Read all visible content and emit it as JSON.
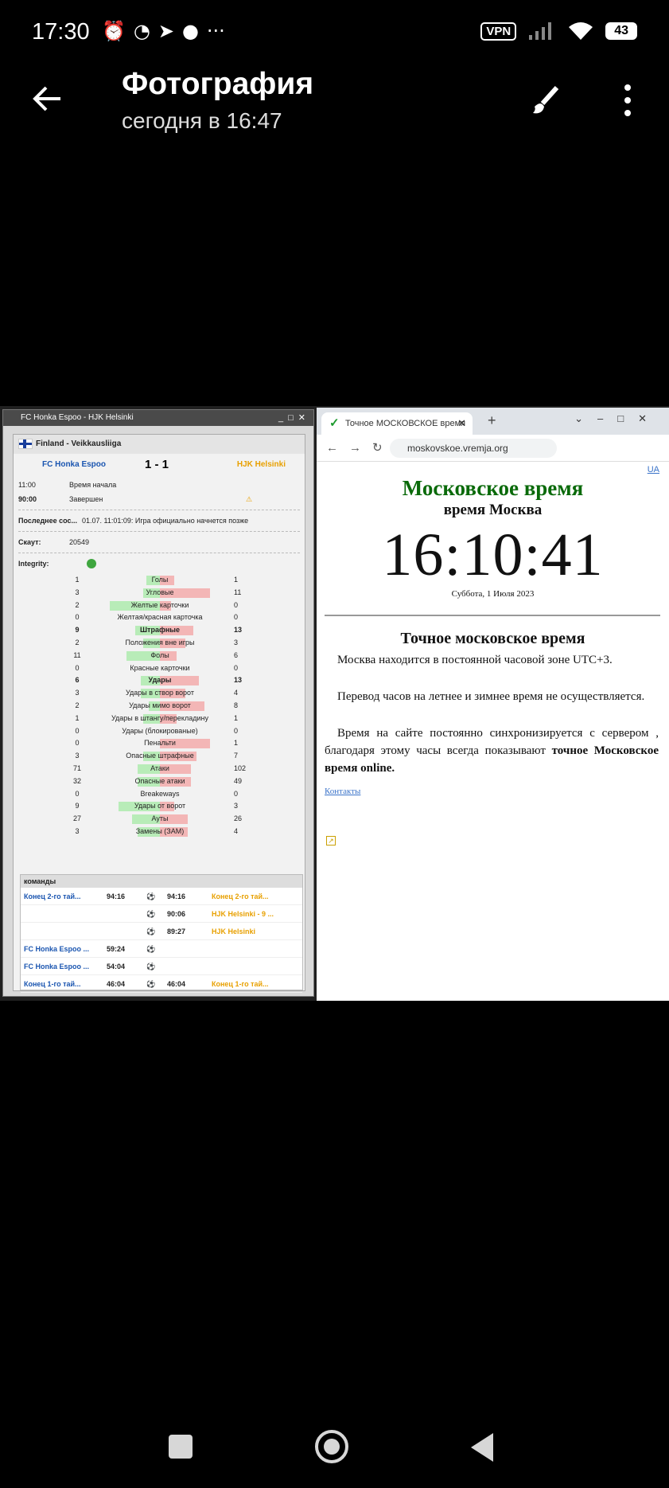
{
  "status": {
    "time": "17:30",
    "vpn": "VPN",
    "battery": "43"
  },
  "appbar": {
    "title": "Фотография",
    "subtitle": "сегодня в 16:47"
  },
  "left_app": {
    "window_title": "FC Honka Espoo - HJK Helsinki",
    "league": "Finland - Veikkausliiga",
    "team1": "FC Honka Espoo",
    "team2": "HJK Helsinki",
    "score": "1 - 1",
    "start_time": "11:00",
    "start_label": "Время начала",
    "minute": "90:00",
    "state": "Завершен",
    "last_msg_label": "Последнее сос...",
    "last_msg": "01.07. 11:01:09: Игра официально начнется позже",
    "scout_label": "Скаут:",
    "scout": "20549",
    "integrity_label": "Integrity:",
    "stats": [
      {
        "l": "1",
        "name": "Голы",
        "r": "1",
        "bold": false,
        "lw": 0.25,
        "rw": 0.25
      },
      {
        "l": "3",
        "name": "Угловые",
        "r": "11",
        "bold": false,
        "lw": 0.3,
        "rw": 0.9
      },
      {
        "l": "2",
        "name": "Желтые карточки",
        "r": "0",
        "bold": false,
        "lw": 0.9,
        "rw": 0.2
      },
      {
        "l": "0",
        "name": "Желтая/красная карточка",
        "r": "0",
        "bold": false,
        "lw": 0,
        "rw": 0
      },
      {
        "l": "9",
        "name": "Штрафные",
        "r": "13",
        "bold": true,
        "lw": 0.45,
        "rw": 0.6
      },
      {
        "l": "2",
        "name": "Положения вне игры",
        "r": "3",
        "bold": false,
        "lw": 0.3,
        "rw": 0.45
      },
      {
        "l": "11",
        "name": "Фолы",
        "r": "6",
        "bold": false,
        "lw": 0.6,
        "rw": 0.3
      },
      {
        "l": "0",
        "name": "Красные карточки",
        "r": "0",
        "bold": false,
        "lw": 0,
        "rw": 0
      },
      {
        "l": "6",
        "name": "Удары",
        "r": "13",
        "bold": true,
        "lw": 0.35,
        "rw": 0.7
      },
      {
        "l": "3",
        "name": "Удары в створ ворот",
        "r": "4",
        "bold": false,
        "lw": 0.35,
        "rw": 0.45
      },
      {
        "l": "2",
        "name": "Удары мимо ворот",
        "r": "8",
        "bold": false,
        "lw": 0.2,
        "rw": 0.8
      },
      {
        "l": "1",
        "name": "Удары в штангу/перекладину",
        "r": "1",
        "bold": false,
        "lw": 0.3,
        "rw": 0.3
      },
      {
        "l": "0",
        "name": "Удары (блокированые)",
        "r": "0",
        "bold": false,
        "lw": 0,
        "rw": 0
      },
      {
        "l": "0",
        "name": "Пенальти",
        "r": "1",
        "bold": false,
        "lw": 0,
        "rw": 0.9
      },
      {
        "l": "3",
        "name": "Опасные штрафные",
        "r": "7",
        "bold": false,
        "lw": 0.3,
        "rw": 0.65
      },
      {
        "l": "71",
        "name": "Атаки",
        "r": "102",
        "bold": false,
        "lw": 0.4,
        "rw": 0.55
      },
      {
        "l": "32",
        "name": "Опасные атаки",
        "r": "49",
        "bold": false,
        "lw": 0.4,
        "rw": 0.55
      },
      {
        "l": "0",
        "name": "Breakeways",
        "r": "0",
        "bold": false,
        "lw": 0,
        "rw": 0
      },
      {
        "l": "9",
        "name": "Удары от ворот",
        "r": "3",
        "bold": false,
        "lw": 0.75,
        "rw": 0.25
      },
      {
        "l": "27",
        "name": "Ауты",
        "r": "26",
        "bold": false,
        "lw": 0.5,
        "rw": 0.5
      },
      {
        "l": "3",
        "name": "Замены (ЗАМ)",
        "r": "4",
        "bold": false,
        "lw": 0.4,
        "rw": 0.5
      }
    ],
    "events_header": "команды",
    "events": [
      {
        "left": "Конец 2-го тай...",
        "lt": "94:16",
        "rt": "94:16",
        "right": "Конец 2-го тай..."
      },
      {
        "left": "",
        "lt": "",
        "rt": "90:06",
        "right": "HJK Helsinki - 9 ..."
      },
      {
        "left": "",
        "lt": "",
        "rt": "89:27",
        "right": "HJK Helsinki"
      },
      {
        "left": "FC Honka Espoo ...",
        "lt": "59:24",
        "rt": "",
        "right": ""
      },
      {
        "left": "FC Honka Espoo ...",
        "lt": "54:04",
        "rt": "",
        "right": ""
      },
      {
        "left": "Конец 1-го тай...",
        "lt": "46:04",
        "rt": "46:04",
        "right": "Конец 1-го тай..."
      }
    ]
  },
  "browser": {
    "tab_title": "Точное МОСКОВСКОЕ время",
    "url": "moskovskoe.vremja.org",
    "ua": "UA",
    "heading": "Московское время",
    "subheading": "время Москва",
    "clock": "16:10:41",
    "date": "Суббота, 1 Июля 2023",
    "section_title": "Точное московское время",
    "p1": "Москва находится в постоянной часовой зоне UTC+3.",
    "p2": "Перевод часов на летнее и зимнее время не осуществляется.",
    "p3a": "Время на сайте постоянно синхронизируется с сервером , благодаря этому часы всегда показывают ",
    "p3b": "точное Московское время online.",
    "contacts": "Контакты"
  }
}
